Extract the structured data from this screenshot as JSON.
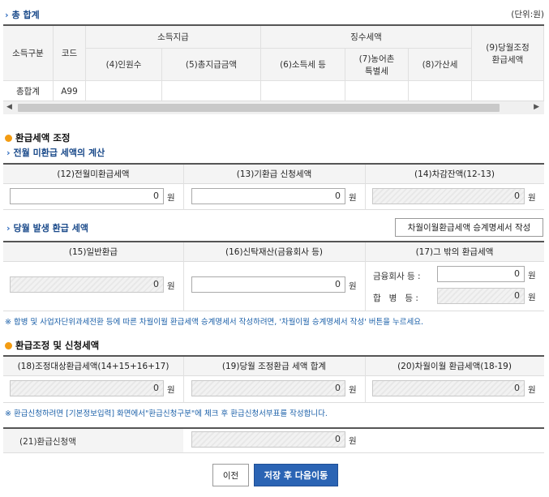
{
  "total": {
    "title": "총 합계",
    "unit": "(단위:원)",
    "headers": {
      "income_type": "소득구분",
      "code": "코드",
      "income_payment": "소득지급",
      "withholding": "징수세액",
      "people": "(4)인원수",
      "total_payment": "(5)총지급금액",
      "income_tax": "(6)소득세 등",
      "rural_tax": "(7)농어촌\n특별세",
      "add_tax": "(8)가산세",
      "adjust_refund": "(9)당월조정\n환급세액"
    },
    "row": {
      "income_type": "총합계",
      "code": "A99"
    }
  },
  "refund_adjust": {
    "title": "환급세액 조정",
    "prev_title": "전월 미환급 세액의 계산",
    "headers": [
      "(12)전월미환급세액",
      "(13)기환급 신청세액",
      "(14)차감잔액(12-13)"
    ],
    "values": [
      "0",
      "0",
      "0"
    ],
    "won": "원",
    "current_title": "당월 발생 환급 세액",
    "carry_button": "차월이월환급세액 승계명세서 작성",
    "current_headers": [
      "(15)일반환급",
      "(16)신탁재산(금융회사 등)",
      "(17)그 밖의 환급세액"
    ],
    "current_values": [
      "0",
      "0"
    ],
    "finance_label": "금융회사 등 :",
    "finance_value": "0",
    "merger_label": "합   병   등 :",
    "merger_value": "0",
    "note1": "※ 합병 및 사업자단위과세전환 등에 따른 차월이월 환급세액 승계명세서 작성하려면, '차월이월 승계명세서 작성' 버튼을 누르세요."
  },
  "apply": {
    "title": "환급조정 및 신청세액",
    "headers": [
      "(18)조정대상환급세액(14+15+16+17)",
      "(19)당월 조정환급 세액 합계",
      "(20)차월이월 환급세액(18-19)"
    ],
    "values": [
      "0",
      "0",
      "0"
    ],
    "note2": "※ 환급신청하려면 [기본정보입력] 화면에서\"환급신청구분\"에 체크 후 환급신청서부표를 작성합니다.",
    "apply_label": "(21)환급신청액",
    "apply_value": "0"
  },
  "buttons": {
    "prev": "이전",
    "save_next": "저장 후 다음이동"
  }
}
